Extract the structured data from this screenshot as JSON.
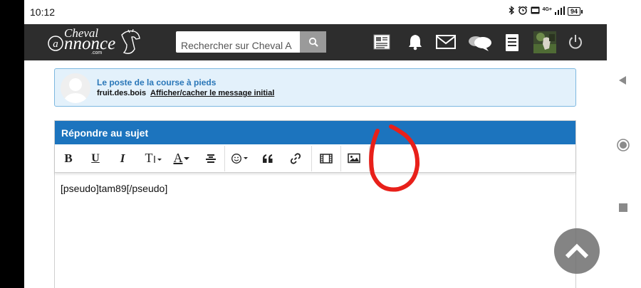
{
  "status_bar": {
    "time": "10:12",
    "network": "4G+",
    "battery": "94"
  },
  "header": {
    "logo": {
      "line1": "Cheval",
      "line2": "nnonce",
      "sub": ".com"
    },
    "search": {
      "placeholder": "Rechercher sur Cheval A"
    },
    "icons": [
      "newspaper-icon",
      "bell-icon",
      "mail-icon",
      "chat-icon",
      "menu-list-icon",
      "profile-avatar",
      "power-icon"
    ]
  },
  "quote": {
    "title": "Le poste de la course à pieds",
    "user": "fruit.des.bois",
    "toggle_label": "Afficher/cacher le message initial"
  },
  "reply": {
    "title": "Répondre au sujet",
    "toolbar": {
      "bold": "B",
      "underline": "U",
      "italic": "I",
      "text_size": "T",
      "font_color": "A"
    },
    "editor_text": "[pseudo]tam89[/pseudo]"
  },
  "colors": {
    "header_bg": "#2d2d2d",
    "reply_header": "#1c74be",
    "quote_bg": "#e3f1fb",
    "quote_title": "#2a77b8",
    "annotation": "#e8201a"
  }
}
